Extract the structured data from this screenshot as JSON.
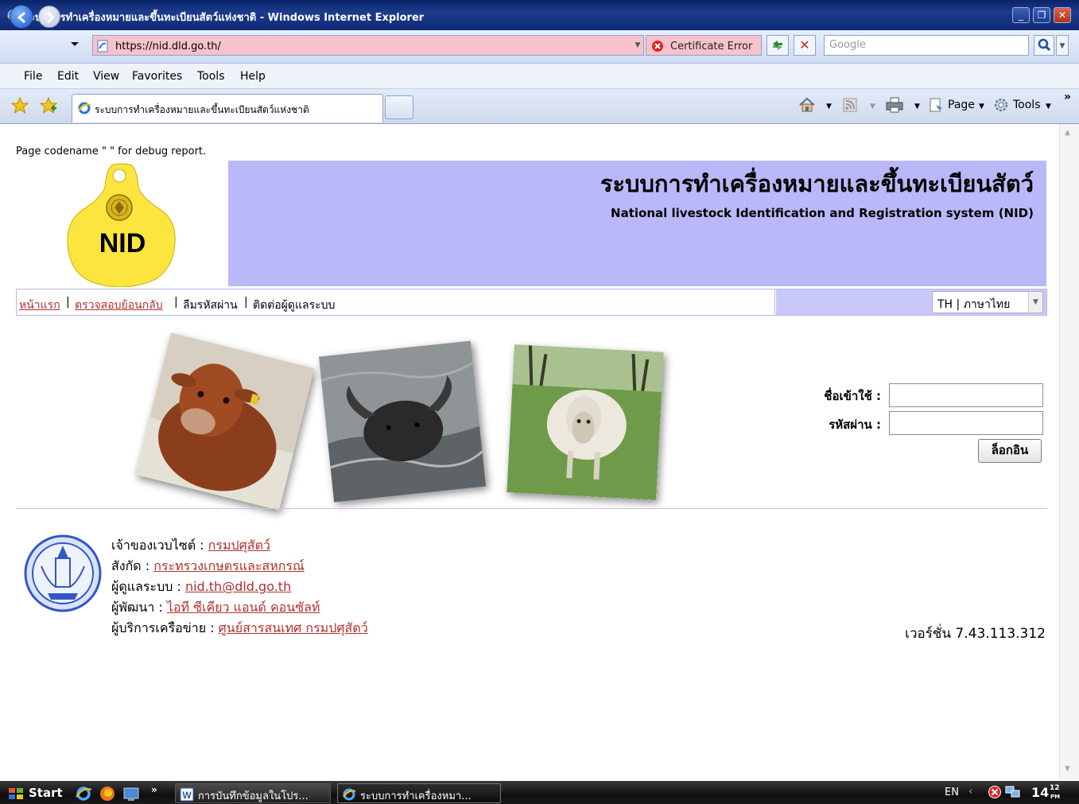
{
  "window": {
    "title": "ระบบการทำเครื่องหมายและขึ้นทะเบียนสัตว์แห่งชาติ - Windows Internet Explorer",
    "minimize": "_",
    "maximize": "❐",
    "close": "✕"
  },
  "address": {
    "url": "https://nid.dld.go.th/",
    "certificate_error": "Certificate Error",
    "search_placeholder": "Google"
  },
  "menu": [
    "File",
    "Edit",
    "View",
    "Favorites",
    "Tools",
    "Help"
  ],
  "tab": {
    "label": "ระบบการทำเครื่องหมายและขึ้นทะเบียนสัตว์แห่งชาติ"
  },
  "command_bar": {
    "page": "Page",
    "tools": "Tools",
    "more": "»"
  },
  "page": {
    "debug": "Page codename \" \" for debug report.",
    "logo_text": "NID",
    "banner_title": "ระบบการทำเครื่องหมายและขึ้นทะเบียนสัตว์",
    "banner_subtitle": "National livestock Identification and Registration system (NID)",
    "nav": {
      "home": "หน้าแรก",
      "traceback": "ตรวจสอบย้อนกลับ",
      "forgot_password": "ลืมรหัสผ่าน",
      "contact_admin": "ติดต่อผู้ดูแลระบบ",
      "separator": "|"
    },
    "language": "TH | ภาษาไทย",
    "login": {
      "username_label": "ชื่อเข้าใช้ :",
      "password_label": "รหัสผ่าน :",
      "username_value": "",
      "password_value": "",
      "button": "ล็อกอิน"
    },
    "info": {
      "owner_label": "เจ้าของเวบไซต์ : ",
      "owner_link": "กรมปศุสัตว์",
      "affiliation_label": "สังกัด : ",
      "affiliation_link": "กระทรวงเกษตรและสหกรณ์",
      "admin_label": "ผู้ดูแลระบบ : ",
      "admin_link": "nid.th@dld.go.th",
      "developer_label": "ผู้พัฒนา : ",
      "developer_link": "ไอที ซีเคียว แอนด์ คอนซัลท์",
      "network_label": "ผู้บริการเครือข่าย : ",
      "network_link": "ศูนย์สารสนเทศ กรมปศุสัตว์"
    },
    "version": "เวอร์ชั่น 7.43.113.312"
  },
  "taskbar": {
    "start": "Start",
    "more": "»",
    "task1": "การบันทึกข้อมูลในโปร...",
    "task2": "ระบบการทำเครื่องหมา...",
    "lang": "EN",
    "chevron": "‹",
    "clock_hour": "14",
    "clock_min": "12",
    "clock_ampm": "PM"
  },
  "colors": {
    "banner": "#b9b9f9",
    "link": "#b03030",
    "address_error": "#f7c2cb",
    "tag_yellow": "#fde540"
  }
}
